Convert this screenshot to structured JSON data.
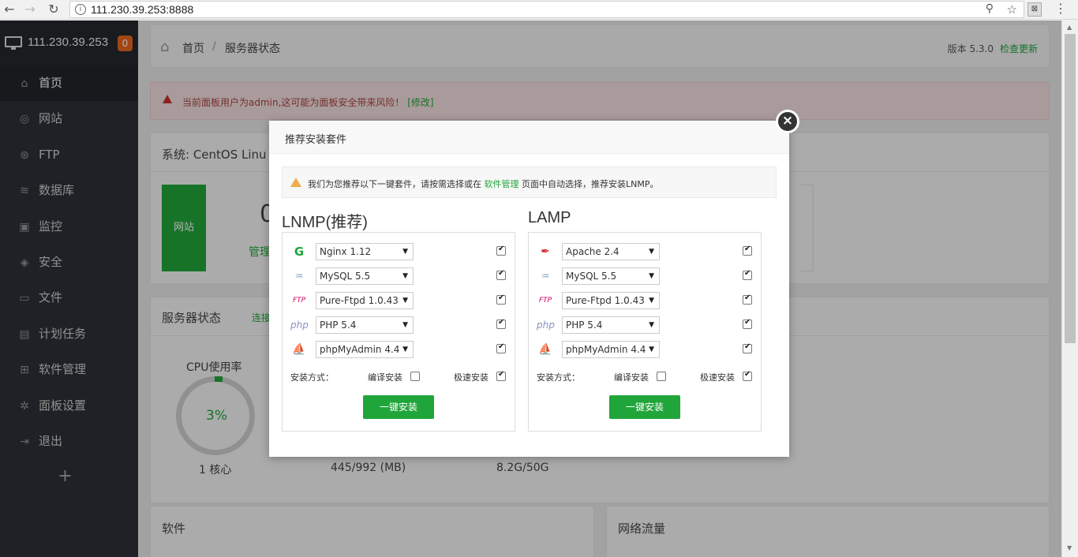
{
  "browser": {
    "url": "111.230.39.253:8888",
    "back": "←",
    "forward": "→",
    "reload": "↻",
    "info": "i",
    "key": "⚲",
    "star": "☆",
    "ext": "⊠",
    "menu": "⋮"
  },
  "sidebar": {
    "host": "111.230.39.253",
    "badge": "0",
    "items": [
      {
        "label": "首页",
        "icon": "⌂"
      },
      {
        "label": "网站",
        "icon": "◎"
      },
      {
        "label": "FTP",
        "icon": "⊛"
      },
      {
        "label": "数据库",
        "icon": "≋"
      },
      {
        "label": "监控",
        "icon": "▣"
      },
      {
        "label": "安全",
        "icon": "◈"
      },
      {
        "label": "文件",
        "icon": "▭"
      },
      {
        "label": "计划任务",
        "icon": "▤"
      },
      {
        "label": "软件管理",
        "icon": "⊞"
      },
      {
        "label": "面板设置",
        "icon": "✲"
      },
      {
        "label": "退出",
        "icon": "⇥"
      }
    ],
    "plus": "+"
  },
  "header": {
    "home": "首页",
    "sep": "/",
    "current": "服务器状态",
    "version": "版本 5.3.0",
    "update": "检查更新"
  },
  "alert": {
    "text": "当前面板用户为admin,这可能为面板安全带来风险！",
    "fix": "[修改]"
  },
  "system": {
    "label": "系统: CentOS Linu",
    "site_tile": "网站",
    "count": "0",
    "manage": "管理"
  },
  "status": {
    "title": "服务器状态",
    "link": "连接",
    "cpu_label": "CPU使用率",
    "cpu_value": "3%",
    "cores": "1 核心",
    "memory": "445/992 (MB)",
    "disk": "8.2G/50G"
  },
  "bottom": {
    "software": "软件",
    "network": "网络流量"
  },
  "modal": {
    "title": "推荐安装套件",
    "close": "×",
    "tip_before": "我们为您推荐以下一键套件，请按需选择或在",
    "tip_link": "软件管理",
    "tip_after": "页面中自动选择，推荐安装LNMP。",
    "lnmp": {
      "title": "LNMP(推荐)",
      "rows": [
        {
          "icon": "G",
          "value": "Nginx 1.12"
        },
        {
          "icon": "♒",
          "value": "MySQL 5.5"
        },
        {
          "icon": "FTP",
          "value": "Pure-Ftpd 1.0.43"
        },
        {
          "icon": "php",
          "value": "PHP 5.4"
        },
        {
          "icon": "⛵",
          "value": "phpMyAdmin 4.4"
        }
      ],
      "mode": "安装方式：",
      "compile": "编译安装",
      "fast": "极速安装",
      "button": "一键安装"
    },
    "lamp": {
      "title": "LAMP",
      "rows": [
        {
          "icon": "✒",
          "value": "Apache 2.4"
        },
        {
          "icon": "♒",
          "value": "MySQL 5.5"
        },
        {
          "icon": "FTP",
          "value": "Pure-Ftpd 1.0.43"
        },
        {
          "icon": "php",
          "value": "PHP 5.4"
        },
        {
          "icon": "⛵",
          "value": "phpMyAdmin 4.4"
        }
      ],
      "mode": "安装方式：",
      "compile": "编译安装",
      "fast": "极速安装",
      "button": "一键安装"
    }
  },
  "colors": {
    "accent": "#20a53a",
    "sidebar": "#2d3037",
    "badge": "#e8651d"
  }
}
